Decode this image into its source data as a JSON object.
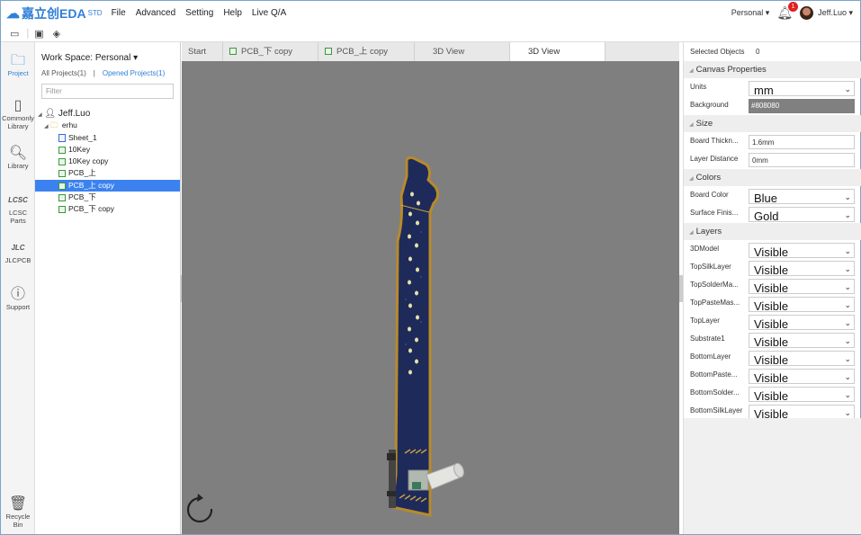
{
  "app": {
    "logo_text": "嘉立创EDA",
    "logo_suffix": "STD",
    "menu": [
      "File",
      "Advanced",
      "Setting",
      "Help",
      "Live Q/A"
    ],
    "workspace_label": "Personal ▾",
    "notification_count": "1",
    "user_label": "Jeff.Luo ▾"
  },
  "leftnav": {
    "project": "Project",
    "common_line1": "Commonly",
    "common_line2": "Library",
    "library": "Library",
    "lcsc_line1": "LCSC",
    "lcsc_line2": "Parts",
    "jlcpcb": "JLCPCB",
    "support": "Support",
    "recycle_line1": "Recycle",
    "recycle_line2": "Bin"
  },
  "project_panel": {
    "workspace": "Work Space: Personal ▾",
    "all_projects": "All Projects(1)",
    "separator": "|",
    "opened_projects": "Opened Projects(1)",
    "filter_placeholder": "Filter",
    "tree": {
      "user": "Jeff.Luo",
      "project": "erhu",
      "items": [
        "Sheet_1",
        "10Key",
        "10Key copy",
        "PCB_上",
        "PCB_上 copy",
        "PCB_下",
        "PCB_下 copy"
      ]
    }
  },
  "tabs": [
    "Start",
    "PCB_下 copy",
    "PCB_上 copy",
    "3D View",
    "3D View"
  ],
  "right_panel": {
    "selected_objects_label": "Selected Objects",
    "selected_objects_value": "0",
    "canvas_properties": "Canvas Properties",
    "units_label": "Units",
    "units_value": "mm",
    "background_label": "Background",
    "background_value": "#808080",
    "size_section": "Size",
    "board_thickness_label": "Board Thickn...",
    "board_thickness_value": "1.6mm",
    "layer_distance_label": "Layer Distance",
    "layer_distance_value": "0mm",
    "colors_section": "Colors",
    "board_color_label": "Board Color",
    "board_color_value": "Blue",
    "surface_finish_label": "Surface Finis...",
    "surface_finish_value": "Gold",
    "layers_section": "Layers",
    "layers": [
      {
        "name": "3DModel",
        "value": "Visible"
      },
      {
        "name": "TopSilkLayer",
        "value": "Visible"
      },
      {
        "name": "TopSolderMa...",
        "value": "Visible"
      },
      {
        "name": "TopPasteMas...",
        "value": "Visible"
      },
      {
        "name": "TopLayer",
        "value": "Visible"
      },
      {
        "name": "Substrate1",
        "value": "Visible"
      },
      {
        "name": "BottomLayer",
        "value": "Visible"
      },
      {
        "name": "BottomPaste...",
        "value": "Visible"
      },
      {
        "name": "BottomSolder...",
        "value": "Visible"
      },
      {
        "name": "BottomSilkLayer",
        "value": "Visible"
      }
    ]
  },
  "colors": {
    "accent": "#2f7fd6",
    "viewport_bg": "#808080",
    "board": "#1d2a5a",
    "board_edge": "#b88a2a"
  }
}
